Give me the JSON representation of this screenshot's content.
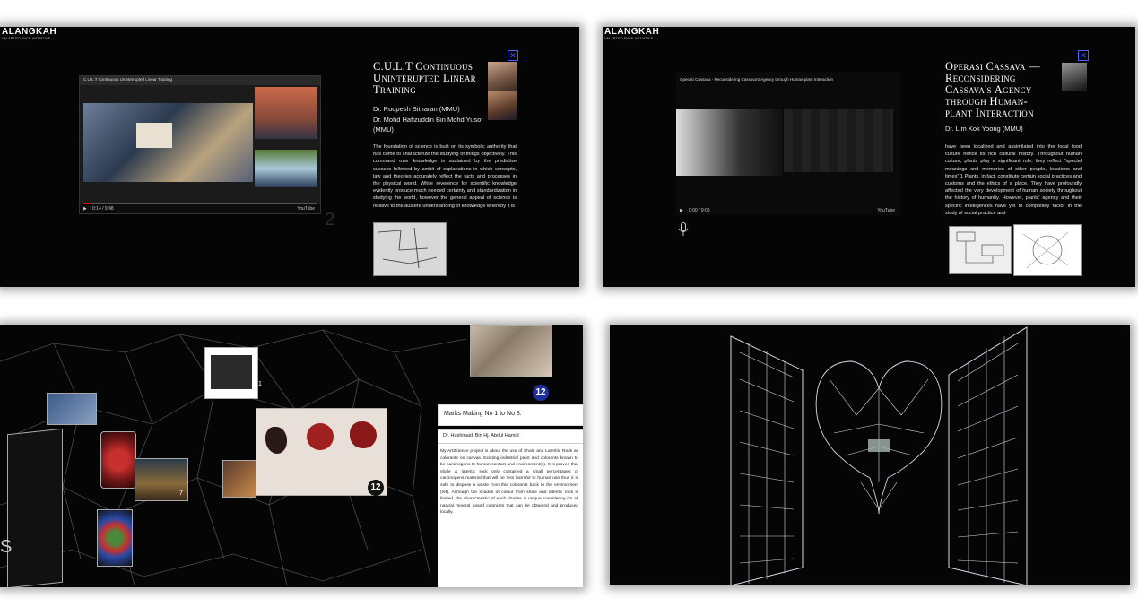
{
  "brand": {
    "name": "ALANGKAH",
    "subtitle": "UM ARTSCIENCE INITIATIVE"
  },
  "panel1": {
    "title": "C.U.L.T Continuous Uninterupted Linear Training",
    "authors": [
      "Dr. Roopesh Sitharan (MMU)",
      "Dr. Mohd Hafizuddin Bin Mohd Yusof (MMU)"
    ],
    "body": "The foundation of science is built on its symbolic authority that has come to characterize the studying of things objectively. This command over knowledge is sustained by the predictive success followed by ambit of explanations in which concepts, law and theories accurately reflect the facts and processes in the physical world. While reverence for scientific knowledge evidently produce much needed certainty and standardization in studying the world, however the general appeal of science is relative to the austere understanding of knowledge whereby it is",
    "video": {
      "title": "C.U.L.T Continuous Uninterrupted Linear Training",
      "time": "0:14 / 9:48",
      "progress": 0.03,
      "brand": "YouTube"
    },
    "close": "✕",
    "watermark": "2"
  },
  "panel2": {
    "title": "Operasi Cassava — Reconsidering Cassava's Agency through Human-plant Interaction",
    "authors": [
      "Dr. Lim Kok Yoong (MMU)"
    ],
    "body": "have been localized and assimilated into the local food culture hence its rich cultural history. Throughout human culture, plants play a significant role; they reflect \"special meanings and memories of other people, locations and times\".1 Plants, in fact, constitute certain social practices and customs and the ethics of a place. They have profoundly affected the very development of human society throughout the history of humanity. However, plants' agency and their specific intelligences have yet to completely factor in the study of social practice and",
    "video": {
      "title": "Operasi Cassava - Reconsidering Cassava's Agency through Human-plant Interaction",
      "time": "0:00 / 9:05",
      "progress": 0.0,
      "brand": "YouTube"
    },
    "close": "✕",
    "mic_icon": "microphone-icon"
  },
  "panel3": {
    "badge": "12",
    "card_title": "Marks Making No 1 to No 8.",
    "card_author": "Dr. Hushinaidi Bin Hj. Abdul Hamid",
    "card_body": "My ArtScience project is about the use of Shale and Lateritic Rock as colorants on canvas. Existing industrial paint and colorants known to be carcinogens to human contact and environment(s). It is proven that shale & lateritic rock only contained a small percentages of carcinogens material that will be less harmful to human use thus it is safe to dispose a waste from this colorants back to the environment (ref). Although the shades of colour from shale and lateritic rock is limited, the characteristic of each shades is unique considering it's all natural mineral based colorants that can be obtained and produced locally.",
    "tile_numbers": [
      "1",
      "7",
      "12"
    ],
    "side_letter": "S"
  },
  "panel4": {
    "description": "wireframe"
  },
  "colors": {
    "accent": "#4a5cff",
    "badge": "#1e2f9e",
    "progress": "#dd0000"
  }
}
